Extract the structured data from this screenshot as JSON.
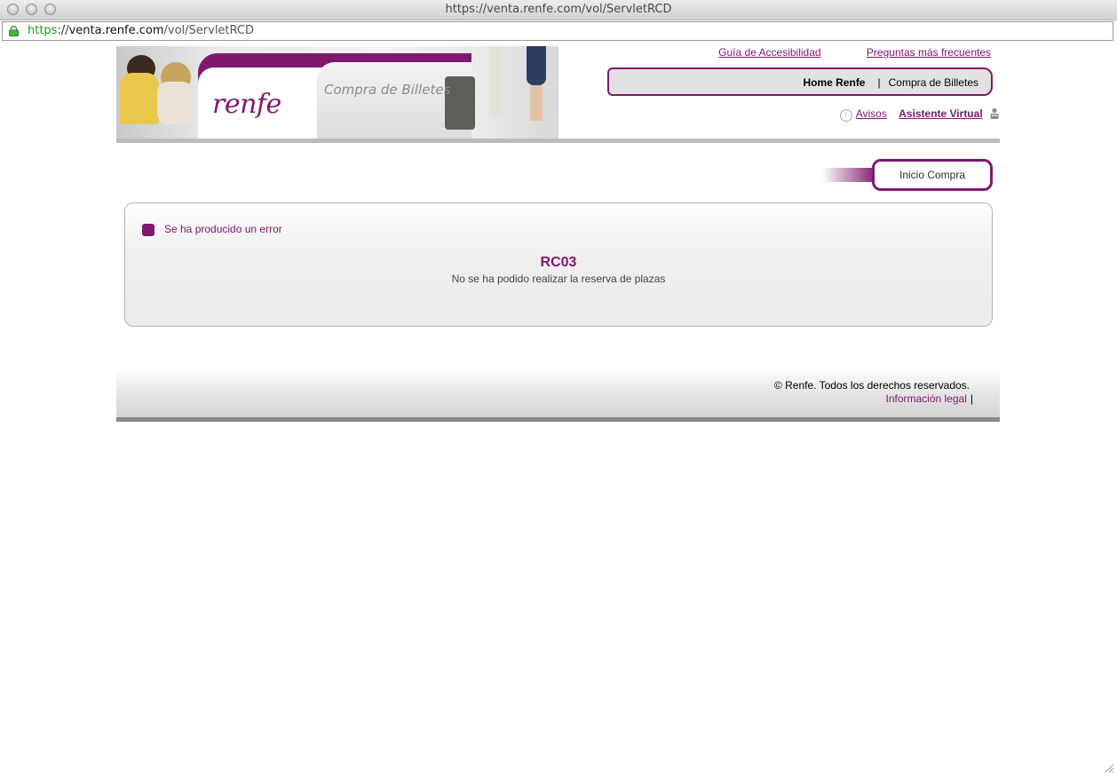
{
  "browser": {
    "title": "https://venta.renfe.com/vol/ServletRCD",
    "url_scheme": "https",
    "url_sep": "://",
    "url_host": "venta.renfe.com",
    "url_path": "/vol/ServletRCD"
  },
  "header": {
    "logo": "renfe",
    "subtitle": "Compra de Billetes",
    "top_links": [
      "Guía de Accesibilidad",
      "Preguntas más frecuentes"
    ],
    "nav": {
      "home": "Home Renfe",
      "separator": "|",
      "current": "Compra de Billetes"
    },
    "avisos": "Avisos",
    "assistant": "Asistente Virtual",
    "warn_glyph": "!"
  },
  "step": {
    "label": "Inicio Compra"
  },
  "error": {
    "title": "Se ha producido un error",
    "code": "RC03",
    "message": "No se ha podido realizar la reserva de plazas"
  },
  "footer": {
    "copyright": "© Renfe. Todos los derechos reservados.",
    "legal": "Información legal",
    "separator": "|"
  },
  "colors": {
    "brand": "#80186e",
    "url_scheme": "#1d9a1d"
  },
  "icons": [
    "lock-icon",
    "warning-icon",
    "virtual-assistant-icon",
    "window-resize-icon"
  ]
}
